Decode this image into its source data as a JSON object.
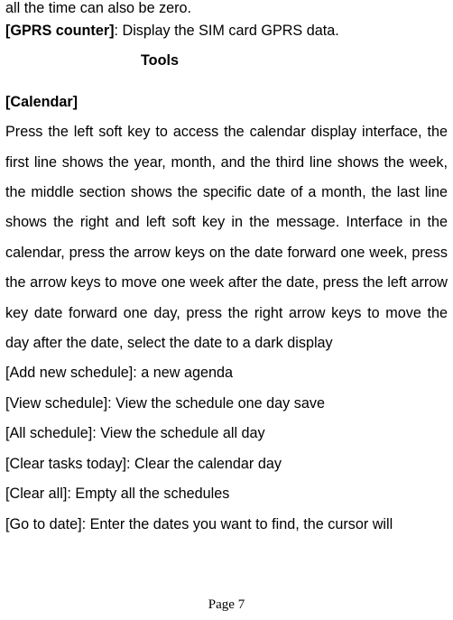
{
  "lines": {
    "l0": "all the time can also be zero.",
    "gprs_label": "[GPRS counter]",
    "gprs_rest": ": Display the SIM card GPRS data.",
    "tools_heading": "Tools",
    "calendar_label": "[Calendar]",
    "p1": "Press the left soft key to access the calendar display interface, the first line shows the year, month, and the third line shows the week, the middle section shows the specific date of a month, the last line shows the right and left soft key in the message. Interface in the calendar, press the arrow keys on the date forward one week, press the arrow keys to move one week after the date, press the left arrow key date forward one day, press the right arrow keys to move the day after the date, select the date to a dark display",
    "l_addnew": "[Add new schedule]: a new agenda",
    "l_viewsched": "[View schedule]: View the schedule one day save",
    "l_allsched": "[All schedule]: View the schedule all day",
    "l_cleartoday": "[Clear tasks today]: Clear the calendar day",
    "l_clearall": "[Clear all]: Empty all the schedules",
    "l_goto": "[Go to date]: Enter the dates you want to find, the cursor will"
  },
  "footer": "Page 7"
}
